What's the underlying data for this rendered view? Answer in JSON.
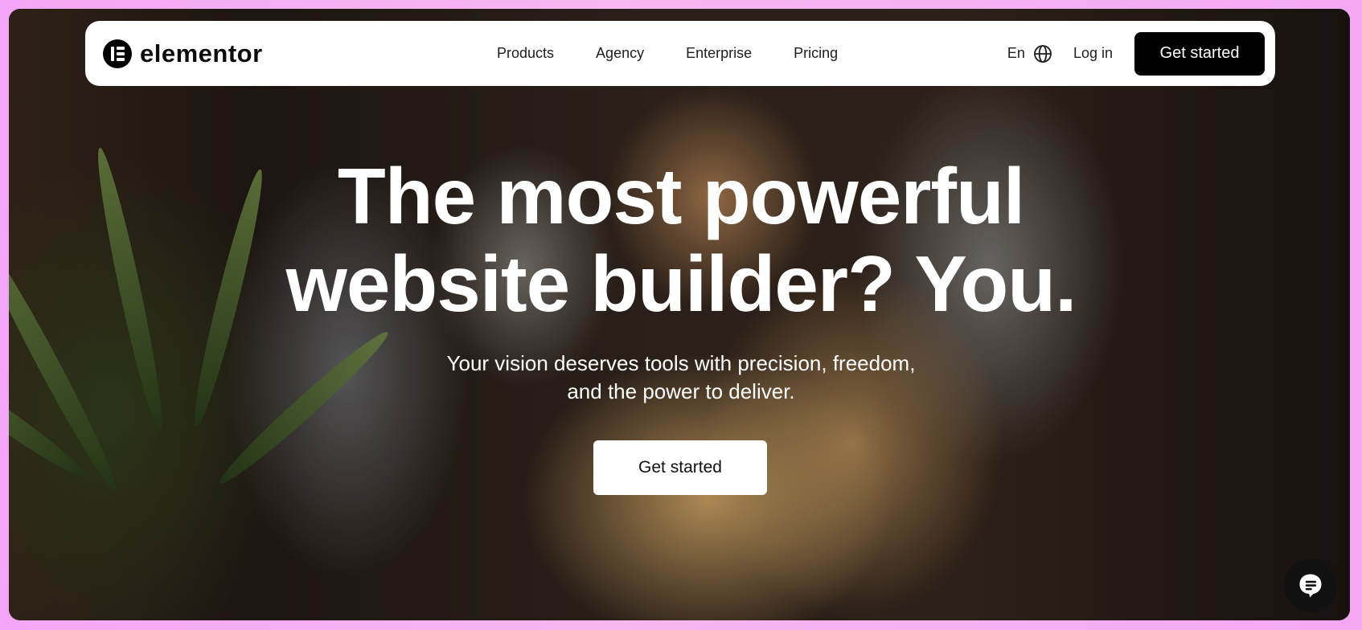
{
  "header": {
    "brand": "elementor",
    "nav": [
      "Products",
      "Agency",
      "Enterprise",
      "Pricing"
    ],
    "language": "En",
    "login": "Log in",
    "cta": "Get started"
  },
  "hero": {
    "title_line1": "The most powerful",
    "title_line2": "website builder? You.",
    "subtitle_line1": "Your vision deserves tools with precision, freedom,",
    "subtitle_line2": "and the power to deliver.",
    "cta": "Get started"
  },
  "colors": {
    "accent": "#000000",
    "page_border": "#f3a6f5"
  },
  "icons": {
    "logo": "elementor-logo-icon",
    "language": "globe-icon",
    "chat": "chat-icon"
  }
}
